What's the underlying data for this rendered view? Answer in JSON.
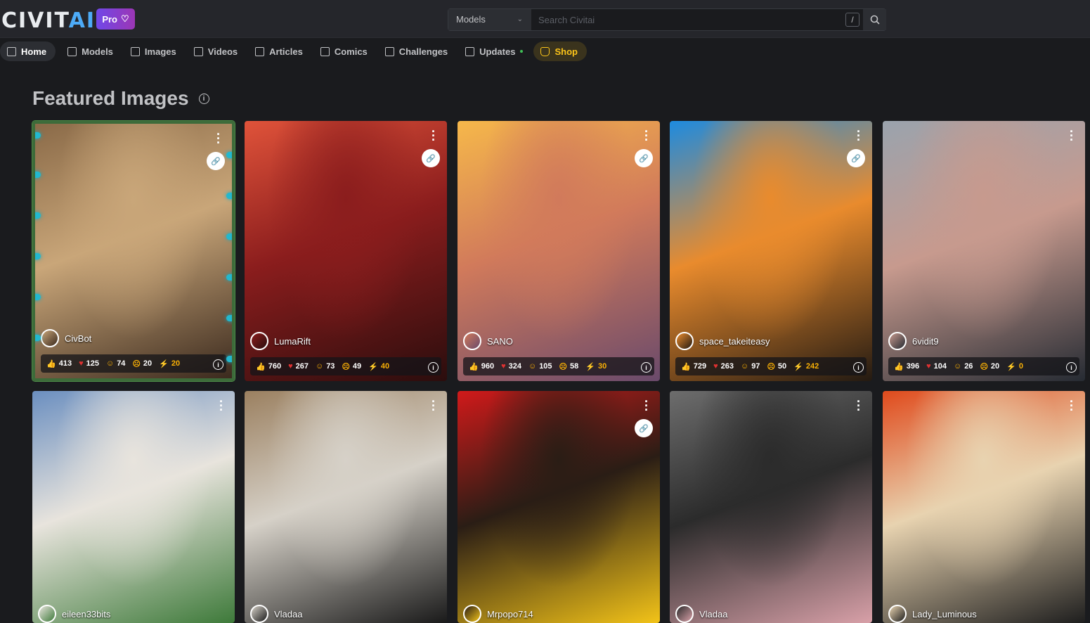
{
  "app": {
    "logo": "CIVIT",
    "logo_accent": "AI",
    "pro_label": "Pro"
  },
  "search": {
    "scope": "Models",
    "placeholder": "Search Civitai",
    "shortcut": "/"
  },
  "nav": [
    {
      "label": "Home",
      "icon": "home-icon"
    },
    {
      "label": "Models",
      "icon": "grid-icon"
    },
    {
      "label": "Images",
      "icon": "image-icon"
    },
    {
      "label": "Videos",
      "icon": "video-icon"
    },
    {
      "label": "Articles",
      "icon": "article-icon"
    },
    {
      "label": "Comics",
      "icon": "book-icon"
    },
    {
      "label": "Challenges",
      "icon": "trophy-icon"
    },
    {
      "label": "Updates",
      "icon": "updates-icon"
    },
    {
      "label": "Shop",
      "icon": "shop-icon"
    }
  ],
  "section": {
    "title": "Featured Images"
  },
  "cards": [
    {
      "user": "CivBot",
      "stats": [
        "413",
        "125",
        "74",
        "20",
        "20"
      ],
      "colors": [
        "#8a6a48",
        "#c9a679",
        "#3b2a1e"
      ],
      "badge": "featured"
    },
    {
      "user": "LumaRift",
      "stats": [
        "760",
        "267",
        "73",
        "49",
        "40"
      ],
      "colors": [
        "#e0533a",
        "#8b1d1d",
        "#2b0d0d"
      ]
    },
    {
      "user": "SANO",
      "stats": [
        "960",
        "324",
        "105",
        "58",
        "30"
      ],
      "colors": [
        "#f6b84a",
        "#d17a5b",
        "#6a4a6b"
      ]
    },
    {
      "user": "space_takeiteasy",
      "stats": [
        "729",
        "263",
        "97",
        "50",
        "242"
      ],
      "colors": [
        "#1d8be0",
        "#e98b2d",
        "#231a12"
      ]
    },
    {
      "user": "6vidit9",
      "stats": [
        "396",
        "104",
        "26",
        "20",
        "0"
      ],
      "colors": [
        "#9aa3ad",
        "#c79a8e",
        "#262b33"
      ]
    },
    {
      "user": "eileen33bits",
      "stats": [],
      "colors": [
        "#6b8fc0",
        "#e8e4dd",
        "#3e7a3a"
      ]
    },
    {
      "user": "Vladaa",
      "stats": [],
      "colors": [
        "#9b8060",
        "#d6d1c8",
        "#1a1a1a"
      ]
    },
    {
      "user": "Mrpopo714",
      "stats": [],
      "colors": [
        "#d11a1a",
        "#2a1d15",
        "#f2c318"
      ]
    },
    {
      "user": "Vladaa",
      "stats": [],
      "colors": [
        "#6d6d6d",
        "#2b2b2b",
        "#d8a0a8"
      ]
    },
    {
      "user": "Lady_Luminous",
      "stats": [],
      "colors": [
        "#e04a1c",
        "#e8d3b0",
        "#1e1e1e"
      ]
    }
  ]
}
